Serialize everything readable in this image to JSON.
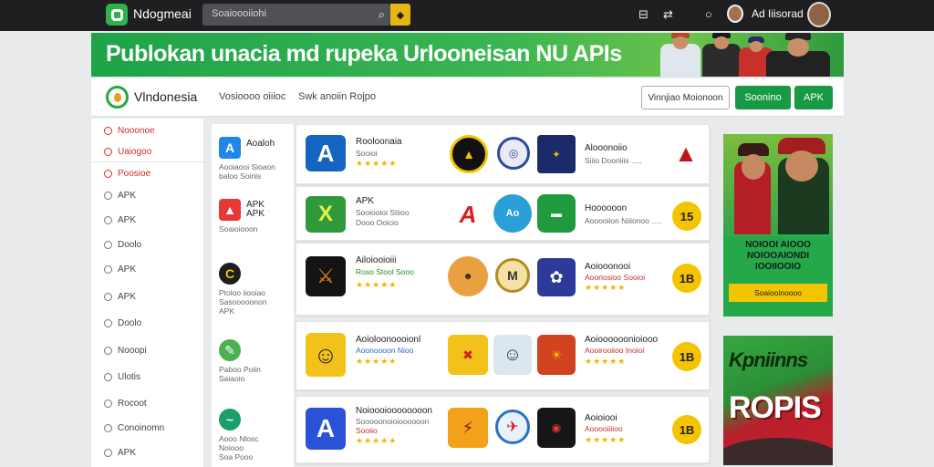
{
  "topbar": {
    "brand": "Ndogmeai",
    "search_text": "Soaioooiiohi",
    "user_name": "Ad  Iiisorad"
  },
  "banner": {
    "title": "Publokan unacia md rupeka Urlooneisan NU APIs"
  },
  "subheader": {
    "site_name": "Vlndonesia",
    "links": [
      "Vosioooo oiiioc",
      "Swk anoiin Rojpo"
    ],
    "outline_button": "Vinnjiao Moionoon",
    "green_button_1": "Soonino",
    "green_button_2": "APK"
  },
  "sidebar": {
    "items": [
      {
        "label": "Nooonoe",
        "highlight": true
      },
      {
        "label": "Uaiogoo",
        "highlight": true
      },
      {
        "label": "Poosioe",
        "highlight": true
      },
      {
        "label": "APK",
        "highlight": false
      },
      {
        "label": "APK",
        "highlight": false
      },
      {
        "label": "Doolo",
        "highlight": false
      },
      {
        "label": "APK",
        "highlight": false
      },
      {
        "label": "APK",
        "highlight": false
      },
      {
        "label": "Doolo",
        "highlight": false
      },
      {
        "label": "Nooopi",
        "highlight": false
      },
      {
        "label": "Ulotis",
        "highlight": false
      },
      {
        "label": "Rocoot",
        "highlight": false
      },
      {
        "label": "Conoinomn",
        "highlight": false
      },
      {
        "label": "APK",
        "highlight": false
      }
    ]
  },
  "categories": [
    {
      "title": "Aoaloh",
      "sub": "Aooiaooi Sioaon\nbaloo Soinis",
      "icon": "A",
      "color": "#1e88e5"
    },
    {
      "title": "APK\nAPK",
      "sub": "Soaioiooon",
      "icon": "▲",
      "color": "#e53935"
    },
    {
      "title": "",
      "sub": "Ptoloo iiooiao\nSasooooonon\nAPK",
      "icon": "C",
      "color": "#1d1d1d"
    },
    {
      "title": "",
      "sub": "Paboo Poiin\nSaiaoio",
      "icon": "✎",
      "color": "#4caf50"
    },
    {
      "title": "",
      "sub": "Aooo Nlosc\nNoiooo\nSoa Pooo",
      "icon": "~",
      "color": "#1a9e6a"
    }
  ],
  "rows": [
    {
      "name": "Rooloonaia",
      "sub1": "Sooioi",
      "sub2": "",
      "stars": "★★★★★",
      "icon": "A",
      "icon_color": "#1565c0",
      "right_name": "Alooonoiio",
      "right_sub": "Siiio Dooriiiis .....",
      "right_stars": "",
      "right_badge": "▲"
    },
    {
      "name": "APK",
      "sub1": "Sooiooioi Stiioo",
      "sub2": "Dooo Ooicio",
      "stars": "",
      "icon": "X",
      "icon_color": "#2e9a3c",
      "right_name": "Hoooooon",
      "right_sub": "Aooooiion Niiionoo .....",
      "right_stars": "",
      "right_badge": "15"
    },
    {
      "name": "Ailoiooioiii",
      "sub1": "Roso Stool Sooo",
      "sub2": "",
      "stars": "★★★★★",
      "icon": "⚔",
      "icon_color": "#141414",
      "right_name": "Aoiooonooi",
      "right_sub": "Aooriosioo Sooioi",
      "right_stars": "★★★★★",
      "right_badge": "1B"
    },
    {
      "name": "Aoioloonoooionl",
      "sub1": "Aoonoooon Nioo",
      "sub2": "",
      "stars": "★★★★★",
      "icon": "☺",
      "icon_color": "#f3c21a",
      "right_name": "Aoioooooonioiooo",
      "right_sub": "Aooirooiioo Inoioi",
      "right_stars": "★★★★★",
      "right_badge": "1B"
    },
    {
      "name": "Noioooioooooooon",
      "sub1": "Sooooonoioioooooon",
      "sub2": "Sooiio",
      "stars": "★★★★★",
      "icon": "A",
      "icon_color": "#2952d8",
      "right_name": "Aoioiooi",
      "right_sub": "Aooooiiiioo",
      "right_stars": "★★★★★",
      "right_badge": "1B"
    }
  ],
  "ads": {
    "ad1_text": "NOIOOI AIOOO\nNOIOOAIONDI\nIOOIIOOIO",
    "ad1_footer": "Soaiooinoooo",
    "ad2_line1": "Kpniinns",
    "ad2_line2": "ROPIS"
  },
  "colors": {
    "brand_green": "#189943",
    "accent_yellow": "#e6b616",
    "topbar_bg": "#1f1f21",
    "highlight_red": "#d22c2c"
  }
}
